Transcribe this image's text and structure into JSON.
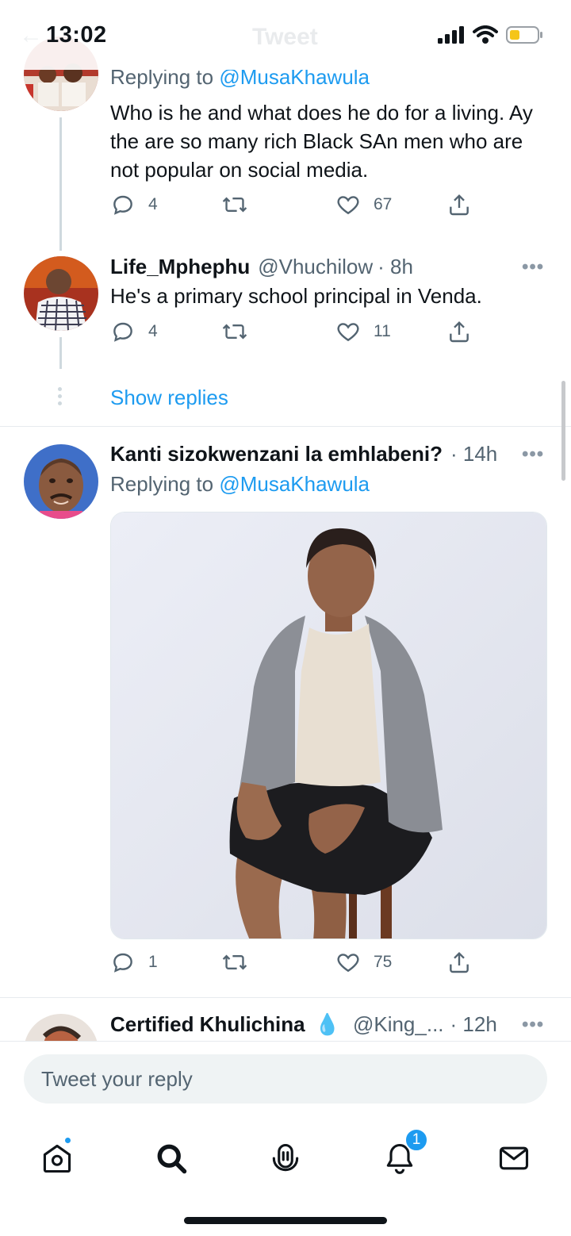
{
  "status_bar": {
    "time": "13:02",
    "ghost_title": "Tweet"
  },
  "replies": [
    {
      "replying_prefix": "Replying to ",
      "replying_to": "@MusaKhawula",
      "text": "Who is he and what does he do for a living. Ay the are so many rich Black SAn men who are not popular on social media.",
      "reply_count": "4",
      "retweet_count": "",
      "like_count": "67"
    },
    {
      "display_name": "Life_Mphephu",
      "handle": "@Vhuchilow",
      "time": "· 8h",
      "text": "He's a primary school principal in Venda.",
      "reply_count": "4",
      "retweet_count": "",
      "like_count": "11"
    },
    {
      "display_name": "Kanti sizokwenzani la emhlabeni?",
      "time": "· 14h",
      "replying_prefix": "Replying to ",
      "replying_to": "@MusaKhawula",
      "reply_count": "1",
      "retweet_count": "",
      "like_count": "75"
    },
    {
      "display_name": "Certified Khulichina",
      "emoji": "💧",
      "handle": "@King_...",
      "time": "· 12h"
    }
  ],
  "show_replies_label": "Show replies",
  "more_glyph": "•••",
  "reply_input": {
    "placeholder": "Tweet your reply"
  },
  "tab_bar": {
    "tabs": [
      {
        "icon": "home-icon",
        "badge": "dot"
      },
      {
        "icon": "search-icon"
      },
      {
        "icon": "spaces-icon"
      },
      {
        "icon": "notifications-icon",
        "badge": "1"
      },
      {
        "icon": "messages-icon"
      }
    ],
    "notifications_badge": "1"
  },
  "colors": {
    "accent": "#1d9bf0",
    "text": "#0f1419",
    "secondary": "#536471"
  }
}
